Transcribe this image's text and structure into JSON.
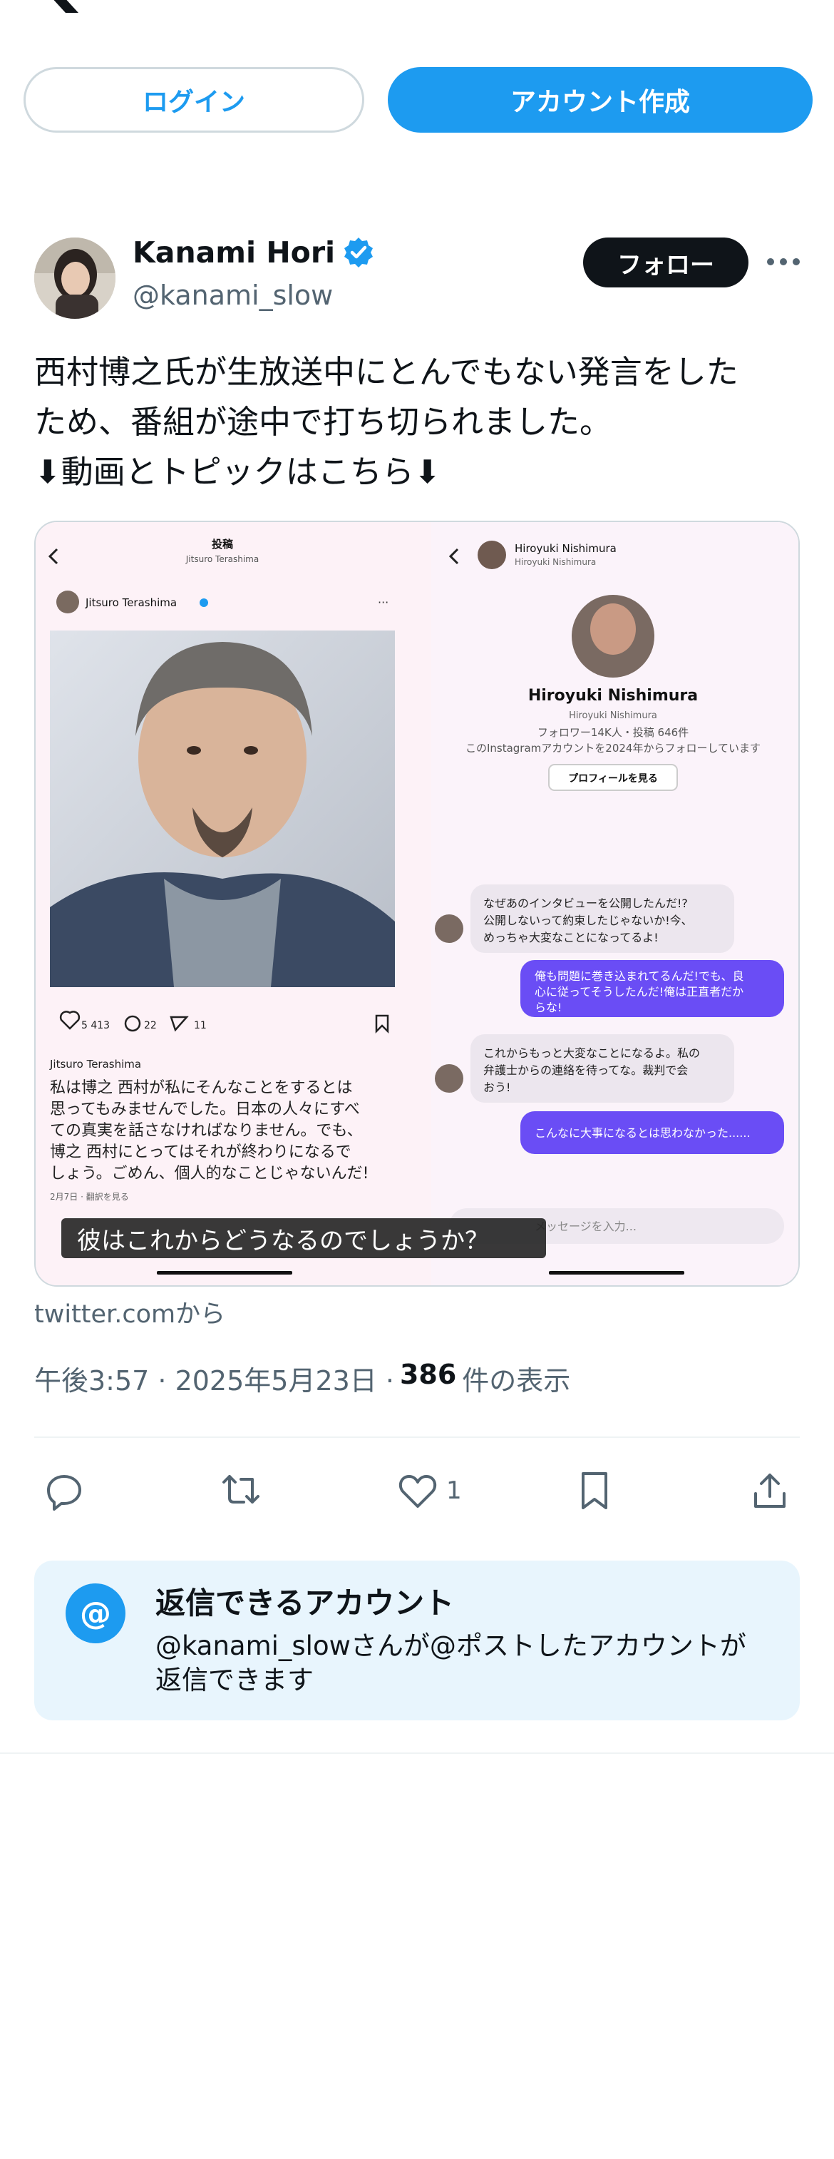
{
  "header": {
    "login_label": "ログイン",
    "signup_label": "アカウント作成"
  },
  "tweet": {
    "author_name": "Kanami Hori",
    "author_handle": "@kanami_slow",
    "follow_label": "フォロー",
    "text_lines": [
      "西村博之氏が生放送中にとんでもない発言をした",
      "ため、番組が途中で打ち切られました。",
      "⬇動画とトピックはこちら⬇"
    ],
    "media": {
      "caption": "彼はこれからどうなるのでしょうか？",
      "left_header_title": "投稿",
      "left_header_sub": "Jitsuro Terashima",
      "post_user": "Jitsuro Terashima",
      "likes": "5 413",
      "comments": "22",
      "shares": "11",
      "post_author": "Jitsuro Terashima",
      "post_text": [
        "私は博之 西村が私にそんなことをするとは",
        "思ってもみませんでした。日本の人々にすべ",
        "ての真実を話さなければなりません。でも、",
        "博之 西村にとってはそれが終わりになるで",
        "しょう。ごめん、個人的なことじゃないんだ!"
      ],
      "post_date": "2月7日 · 翻訳を見る",
      "right_header_name": "Hiroyuki Nishimura",
      "right_header_sub": "Hiroyuki Nishimura",
      "profile_name": "Hiroyuki Nishimura",
      "profile_sub": "Hiroyuki Nishimura",
      "profile_stats": "フォロワー14K人・投稿 646件",
      "profile_follow_info": "このInstagramアカウントを2024年からフォローしています",
      "profile_button": "プロフィールを見る",
      "msg1": [
        "なぜあのインタビューを公開したんだ!?",
        "公開しないって約束したじゃないか!今、",
        "めっちゃ大変なことになってるよ!"
      ],
      "msg2": [
        "俺も問題に巻き込まれてるんだ!でも、良",
        "心に従ってそうしたんだ!俺は正直者だか",
        "らな!"
      ],
      "msg3": [
        "これからもっと大変なことになるよ。私の",
        "弁護士からの連絡を待ってな。裁判で会",
        "おう!"
      ],
      "msg4": "こんなに大事になるとは思わなかった......",
      "input_placeholder": "メッセージを入力..."
    },
    "source": "twitter.comから",
    "time": "午後3:57 · 2025年5月23日 ·",
    "views_count": "386",
    "views_label": "件の表示",
    "like_count": "1"
  },
  "reply_settings": {
    "title": "返信できるアカウント",
    "description": "@kanami_slowさんが@ポストしたアカウントが返信できます"
  },
  "colors": {
    "accent": "#1d9bf0",
    "text": "#0f1419",
    "muted": "#536471"
  }
}
